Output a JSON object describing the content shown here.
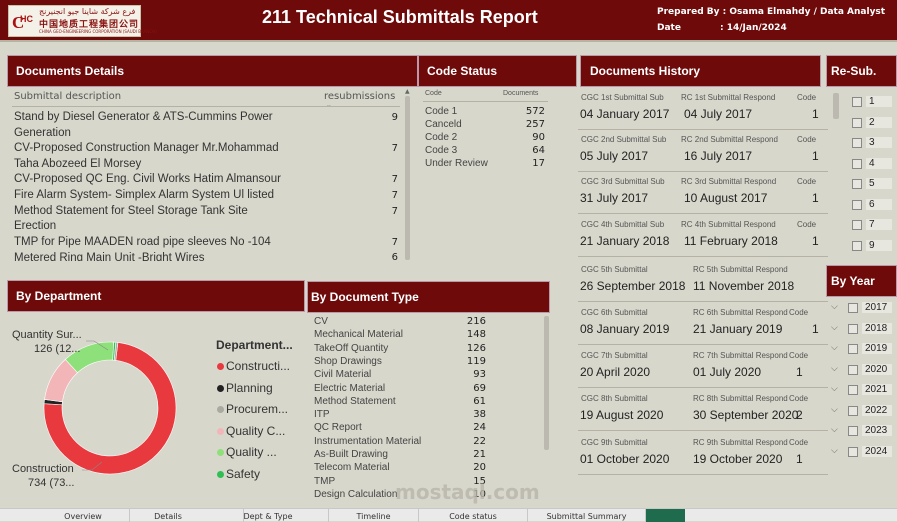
{
  "header": {
    "title": "211 Technical Submittals Report",
    "prepared_by": "Prepared By : Osama Elmahdy /  Data Analyst",
    "date_label": "Date",
    "date_value": ":  14/Jan/2024",
    "logo_arabic": "فرع شركة شاينا جيو انجنيرنج",
    "logo_chinese": "中国地质工程集团公司",
    "logo_english": "CHINA GEO-ENGINEERING CORPORATION (SAUDI BRANCH)"
  },
  "documents_details": {
    "panel_title": "Documents Details",
    "col_desc": "Submittal description",
    "col_resub": "resubmissions",
    "rows": [
      {
        "desc": "Stand by Diesel Generator & ATS-Cummins Power",
        "desc2": "Generation",
        "val": "9"
      },
      {
        "desc": "CV-Proposed Construction Manager Mr.Mohammad",
        "desc2": "Taha Abozeed El Morsey",
        "val": "7"
      },
      {
        "desc": "CV-Proposed QC Eng. Civil Works Hatim Almansour",
        "desc2": "",
        "val": "7"
      },
      {
        "desc": "Fire Alarm System- Simplex Alarm System Ul listed",
        "desc2": "",
        "val": "7"
      },
      {
        "desc": "Method Statement for Steel Storage Tank Site",
        "desc2": "Erection",
        "val": "7"
      },
      {
        "desc": "TMP for Pipe MAADEN road pipe sleeves No -104",
        "desc2": "",
        "val": "7"
      },
      {
        "desc": "Metered Ring Main Unit -Bright Wires",
        "desc2": "",
        "val": "6"
      }
    ]
  },
  "code_status": {
    "panel_title": "Code Status",
    "col_code": "Code",
    "col_docs": "Documents",
    "rows": [
      {
        "code": "Code 1",
        "count": "572"
      },
      {
        "code": "Canceld",
        "count": "257"
      },
      {
        "code": "Code 2",
        "count": "90"
      },
      {
        "code": "Code 3",
        "count": "64"
      },
      {
        "code": "Under Review",
        "count": "17"
      }
    ]
  },
  "documents_history": {
    "panel_title": "Documents History",
    "entries": [
      {
        "sub_label": "CGC 1st Submittal Sub",
        "resp_label": "RC 1st Submittal Respond",
        "code_label": "Code",
        "sub_date": "04 January 2017",
        "resp_date": "04 July 2017",
        "code": "1"
      },
      {
        "sub_label": "CGC 2nd Submittal Sub",
        "resp_label": "RC 2nd Submittal Respond",
        "code_label": "Code",
        "sub_date": "05 July 2017",
        "resp_date": "16 July 2017",
        "code": "1"
      },
      {
        "sub_label": "CGC 3rd Submittal Sub",
        "resp_label": "RC 3rd Submittal Respond",
        "code_label": "Code",
        "sub_date": "31 July 2017",
        "resp_date": "10 August 2017",
        "code": "1"
      },
      {
        "sub_label": "CGC 4th Submittal Sub",
        "resp_label": "RC 4th Submittal Respond",
        "code_label": "Code",
        "sub_date": "21 January 2018",
        "resp_date": "11 February 2018",
        "code": "1"
      },
      {
        "sub_label": "CGC 5th Submittal",
        "resp_label": "RC 5th Submittal Respond",
        "code_label": "",
        "sub_date": "26 September 2018",
        "resp_date": "11 November 2018",
        "code": ""
      },
      {
        "sub_label": "CGC 6th Submittal",
        "resp_label": "RC 6th Submittal Respond",
        "code_label": "Code",
        "sub_date": "08 January 2019",
        "resp_date": "21 January 2019",
        "code": "1"
      },
      {
        "sub_label": "CGC 7th Submittal",
        "resp_label": "RC 7th Submittal Respond",
        "code_label": "Code",
        "sub_date": "20 April 2020",
        "resp_date": "01 July 2020",
        "code": "1"
      },
      {
        "sub_label": "CGC 8th Submittal",
        "resp_label": "RC 8th Submittal Respond",
        "code_label": "Code",
        "sub_date": "19 August 2020",
        "resp_date": "30 September 2020",
        "code": "2"
      },
      {
        "sub_label": "CGC 9th Submittal",
        "resp_label": "RC 9th Submittal Respond",
        "code_label": "Code",
        "sub_date": "01 October 2020",
        "resp_date": "19 October 2020",
        "code": "1"
      }
    ]
  },
  "resub": {
    "panel_title": "Re-Sub.",
    "items": [
      "1",
      "2",
      "3",
      "4",
      "5",
      "6",
      "7",
      "9"
    ]
  },
  "by_year": {
    "panel_title": "By Year",
    "items": [
      "2017",
      "2018",
      "2019",
      "2020",
      "2021",
      "2022",
      "2023",
      "2024"
    ]
  },
  "by_department": {
    "panel_title": "By Department",
    "legend_title": "Department...",
    "label_top_name": "Quantity Sur...",
    "label_top_val": "126 (12...",
    "label_bottom_name": "Construction",
    "label_bottom_val": "734 (73...",
    "legend": [
      {
        "name": "Constructi...",
        "color": "#e8393f"
      },
      {
        "name": "Planning",
        "color": "#222222"
      },
      {
        "name": "Procurem...",
        "color": "#aaaaa0"
      },
      {
        "name": "Quality C...",
        "color": "#f2b6b8"
      },
      {
        "name": "Quality ...",
        "color": "#8de07a"
      },
      {
        "name": "Safety",
        "color": "#2fbf55"
      }
    ]
  },
  "chart_data": {
    "type": "pie",
    "categories": [
      "Construction",
      "Planning",
      "Procurement",
      "Quality C",
      "Quantity Surveying",
      "Safety"
    ],
    "values": [
      734,
      10,
      5,
      110,
      126,
      5
    ],
    "colors": [
      "#e8393f",
      "#222222",
      "#aaaaa0",
      "#f2b6b8",
      "#8de07a",
      "#2fbf55"
    ]
  },
  "by_document_type": {
    "panel_title": "By Document Type",
    "rows": [
      {
        "name": "CV",
        "val": "216"
      },
      {
        "name": "Mechanical Material",
        "val": "148"
      },
      {
        "name": "TakeOff Quantity",
        "val": "126"
      },
      {
        "name": "Shop Drawings",
        "val": "119"
      },
      {
        "name": "Civil Material",
        "val": "93"
      },
      {
        "name": "Electric Material",
        "val": "69"
      },
      {
        "name": "Method Statement",
        "val": "61"
      },
      {
        "name": "ITP",
        "val": "38"
      },
      {
        "name": "QC Report",
        "val": "24"
      },
      {
        "name": "Instrumentation Material",
        "val": "22"
      },
      {
        "name": "As-Built Drawing",
        "val": "21"
      },
      {
        "name": "Telecom Material",
        "val": "20"
      },
      {
        "name": "TMP",
        "val": "15"
      },
      {
        "name": "Design Calculation",
        "val": "10"
      }
    ]
  },
  "tabs": [
    "Overview",
    "Details",
    "Dept & Type",
    "Timeline",
    "Code status",
    "Submittal Summary"
  ],
  "watermark": "mostaql.com"
}
